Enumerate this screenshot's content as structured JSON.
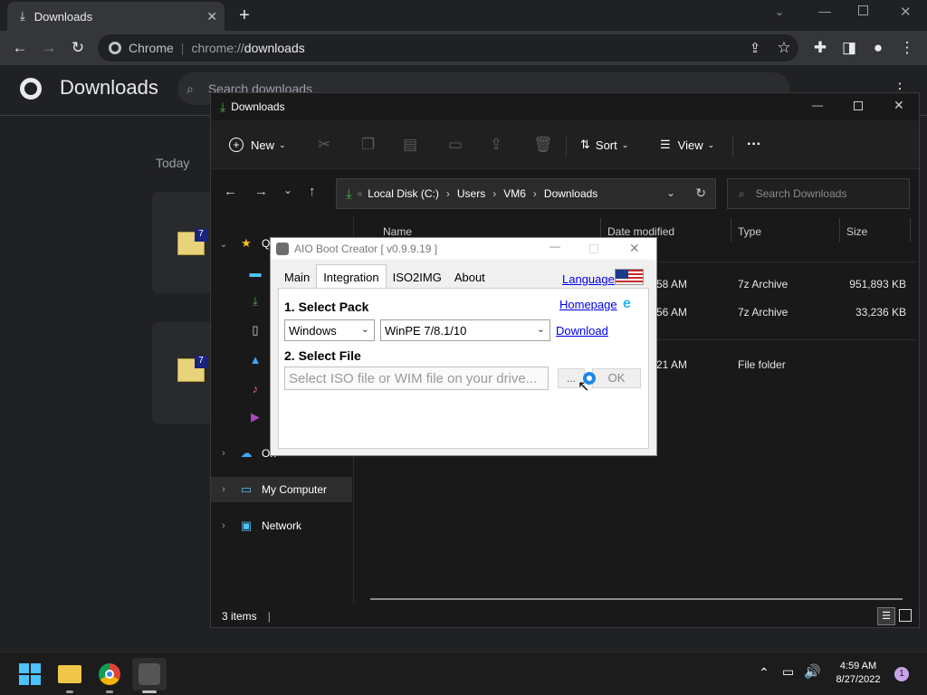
{
  "chrome": {
    "tab_title": "Downloads",
    "omnibox_site": "Chrome",
    "url_prefix": "chrome://",
    "url_path": "downloads"
  },
  "downloads_page": {
    "title": "Downloads",
    "search_placeholder": "Search downloads",
    "section_today": "Today"
  },
  "explorer": {
    "title": "Downloads",
    "commands": {
      "new": "New",
      "sort": "Sort",
      "view": "View"
    },
    "breadcrumb": [
      "Local Disk (C:)",
      "Users",
      "VM6",
      "Downloads"
    ],
    "search_placeholder": "Search Downloads",
    "nav": {
      "quick_access": "Qu",
      "items": [
        "D",
        "D",
        "D",
        "P",
        "M",
        "V"
      ],
      "onedrive": "On",
      "my_computer": "My Computer",
      "network": "Network"
    },
    "columns": {
      "name": "Name",
      "date": "Date modified",
      "type": "Type",
      "size": "Size"
    },
    "files": [
      {
        "date": "4:58 AM",
        "type": "7z Archive",
        "size": "951,893 KB"
      },
      {
        "date": "4:56 AM",
        "type": "7z Archive",
        "size": "33,236 KB"
      },
      {
        "date": "1:21 AM",
        "type": "File folder",
        "size": ""
      }
    ],
    "status": "3 items"
  },
  "aio": {
    "title": "AIO Boot Creator [ v0.9.9.19 ]",
    "tabs": [
      "Main",
      "Integration",
      "ISO2IMG",
      "About"
    ],
    "active_tab": "Integration",
    "language_link": "Language",
    "homepage_link": "Homepage",
    "download_link": "Download",
    "select_pack_label": "1. Select Pack",
    "pack_os": "Windows",
    "pack_version": "WinPE 7/8.1/10",
    "select_file_label": "2. Select File",
    "file_placeholder": "Select ISO file or WIM file on your drive...",
    "browse_label": "...",
    "ok_label": "OK"
  },
  "taskbar": {
    "time": "4:59 AM",
    "date": "8/27/2022",
    "notification_count": "1"
  },
  "colors": {
    "chrome_bg": "#202124",
    "explorer_bg": "#191919",
    "accent_green": "#4caf50",
    "link_blue": "#0000ee"
  }
}
